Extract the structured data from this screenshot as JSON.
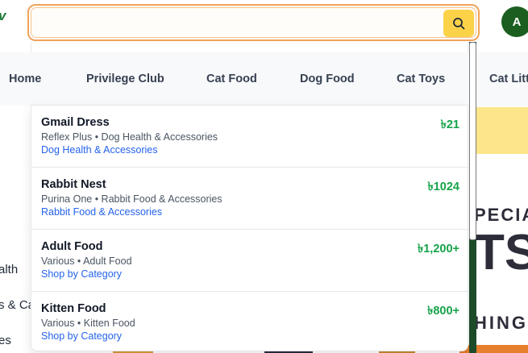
{
  "header": {
    "logo_fragment": "v",
    "search": {
      "value": "",
      "placeholder": ""
    },
    "user_initial": "A"
  },
  "nav": {
    "items": [
      "Home",
      "Privilege Club",
      "Cat Food",
      "Dog Food",
      "Cat Toys",
      "Cat Litter"
    ]
  },
  "background": {
    "side_texts": [
      "alth",
      "s & Ca",
      "es"
    ],
    "promo_texts": [
      "PECIA",
      "TS",
      "HING"
    ]
  },
  "dropdown": {
    "results": [
      {
        "name": "Gmail Dress",
        "meta": "Reflex Plus • Dog Health & Accessories",
        "category": "Dog Health & Accessories",
        "price": "৳21"
      },
      {
        "name": "Rabbit Nest",
        "meta": "Purina One • Rabbit Food & Accessories",
        "category": "Rabbit Food & Accessories",
        "price": "৳1024"
      },
      {
        "name": "Adult Food",
        "meta": "Various • Adult Food",
        "category": "Shop by Category",
        "price": "৳1,200+"
      },
      {
        "name": "Kitten Food",
        "meta": "Various • Kitten Food",
        "category": "Shop by Category",
        "price": "৳800+"
      }
    ]
  },
  "colors": {
    "search_border": "#f0a35a",
    "search_button": "#fcd249",
    "avatar": "#1b5e20",
    "price": "#16a34a",
    "category_link": "#2563eb"
  }
}
